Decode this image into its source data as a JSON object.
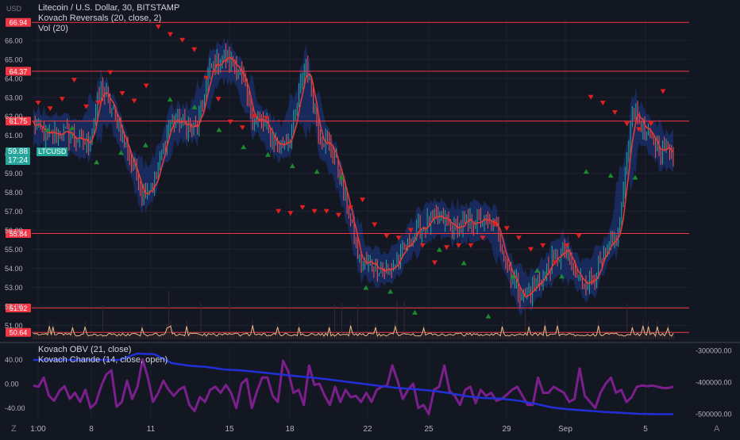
{
  "header": {
    "title": "Litecoin / U.S. Dollar, 30, BITSTAMP",
    "indicator_1": "Kovach Reversals (20, close, 2)",
    "indicator_2": "Vol (20)"
  },
  "currency_label": "USD",
  "lower_pane": {
    "indicator_1": "Kovach OBV (21, close)",
    "indicator_2": "Kovach Chande (14, close, open)"
  },
  "price_tag": {
    "symbol": "LTCUSD",
    "price": "59.88",
    "countdown": "17:24"
  },
  "corner": {
    "z": "Z",
    "a": "A"
  },
  "colors": {
    "background": "#131722",
    "level_line": "#f23645",
    "candle_up": "#26a69a",
    "candle_down": "#ef5350",
    "band": "#1e3a8a",
    "ma": "#e53935",
    "buy_marker": "#1b8a2f",
    "sell_marker": "#e0201f",
    "obv": "#2130d6",
    "chande": "#7b1f8c",
    "volume": "#e9b98a"
  },
  "chart_data": [
    {
      "type": "line",
      "title": "Litecoin / U.S. Dollar, 30, BITSTAMP",
      "x_tick_labels": [
        "1:00",
        "8",
        "11",
        "15",
        "18",
        "22",
        "25",
        "29",
        "Sep",
        "5"
      ],
      "y_tick_labels": [
        "51.00",
        "52.00",
        "53.00",
        "54.00",
        "55.00",
        "56.00",
        "57.00",
        "58.00",
        "59.00",
        "60.00",
        "61.00",
        "62.00",
        "63.00",
        "64.00",
        "65.00",
        "66.00"
      ],
      "ylim": [
        50.4,
        67.2
      ],
      "horizontal_levels": [
        66.94,
        64.37,
        61.75,
        55.84,
        51.92,
        50.64
      ],
      "last_price": 59.88,
      "series": [
        {
          "x": [
            "1:00",
            "3",
            "5",
            "6",
            "7",
            "8",
            "8",
            "9",
            "10",
            "10",
            "11",
            "11",
            "12",
            "13",
            "13",
            "14",
            "14",
            "15",
            "15",
            "16",
            "17",
            "17",
            "18",
            "18",
            "19",
            "20",
            "21",
            "22",
            "22",
            "23",
            "24",
            "25",
            "25",
            "26",
            "27",
            "28",
            "29",
            "29",
            "30",
            "31",
            "31",
            "Sep",
            "Sep",
            "3",
            "4",
            "5",
            "5",
            "6"
          ],
          "values": [
            61.6,
            60.9,
            61.2,
            60.9,
            60.5,
            63.5,
            62.0,
            60.0,
            58.0,
            58.6,
            61.8,
            61.6,
            61.3,
            64.5,
            65.1,
            64.7,
            62.1,
            61.5,
            60.4,
            61.1,
            64.9,
            61.0,
            60.2,
            57.5,
            54.2,
            54.3,
            53.8,
            54.6,
            55.9,
            56.4,
            56.6,
            56.1,
            56.4,
            56.5,
            56.2,
            53.8,
            52.4,
            53.2,
            54.2,
            55.0,
            53.4,
            53.4,
            54.6,
            55.9,
            62.5,
            61.1,
            60.3,
            60.2
          ]
        }
      ],
      "sell_markers": [
        62.7,
        62.4,
        62.9,
        63.9,
        62.5,
        62.7,
        64.3,
        63.2,
        62.8,
        63.6,
        66.7,
        66.3,
        66.0,
        65.5,
        64.0,
        62.9,
        61.7,
        61.4,
        62.0,
        61.9,
        57.0,
        56.9,
        57.2,
        57.0,
        57.0,
        56.8,
        57.2,
        57.6,
        56.3,
        55.7,
        55.6,
        56.0,
        55.2,
        54.3,
        55.1,
        55.2,
        55.2,
        55.6,
        56.3,
        56.1,
        55.6,
        55.0,
        55.2,
        54.3,
        55.2,
        55.7,
        63.0,
        62.7,
        62.2,
        61.6,
        61.3,
        61.6,
        63.3
      ],
      "buy_markers": [
        61.3,
        61.4,
        59.6,
        60.1,
        60.5,
        62.9,
        62.5,
        61.3,
        60.4,
        60.0,
        59.4,
        59.1,
        58.8,
        53.0,
        52.8,
        51.7,
        55.0,
        54.3,
        51.5,
        53.6,
        53.9,
        53.6,
        59.1,
        58.9,
        58.8
      ]
    },
    {
      "type": "line",
      "y_tick_labels": [
        "40.00",
        "0.00",
        "-40.00"
      ],
      "ylim": [
        -60,
        60
      ],
      "series": [
        {
          "name": "Kovach OBV (21, close)",
          "axis": "right",
          "values": [
            -330000,
            -330000,
            -330000,
            -330000,
            -330000,
            -330000,
            -310000,
            -312000,
            -340000,
            -348000,
            -352000,
            -360000,
            -363000,
            -368000,
            -374000,
            -380000,
            -385000,
            -391000,
            -398000,
            -405000,
            -412000,
            -418000,
            -422000,
            -427000,
            -434000,
            -444000,
            -450000,
            -452000,
            -458000,
            -468000,
            -480000,
            -486000,
            -490000,
            -494000,
            -497000,
            -500000,
            -501000,
            -501000
          ],
          "right_axis_ticks": [
            "300000.00",
            "400000.00",
            "500000.00"
          ]
        },
        {
          "name": "Kovach Chande (14, close, open)",
          "axis": "left",
          "values": [
            -3,
            -5,
            10,
            -20,
            -28,
            -12,
            -4,
            -25,
            -15,
            -30,
            -10,
            -40,
            -32,
            -5,
            15,
            22,
            -38,
            -30,
            5,
            -25,
            -5,
            40,
            10,
            -30,
            -15,
            5,
            -10,
            -20,
            -10,
            -5,
            -35,
            -45,
            -22,
            -30,
            -10,
            -5,
            -15,
            -2,
            -15,
            -40,
            0,
            8,
            -40,
            -12,
            10,
            10,
            -20,
            -30,
            38,
            20,
            -15,
            -10,
            -35,
            30,
            -2,
            0,
            -20,
            -35,
            -5,
            -30,
            -10,
            -22,
            -20,
            -30,
            -15,
            -30,
            -10,
            -5,
            -3,
            30,
            5,
            -25,
            -10,
            0,
            -40,
            -35,
            -50,
            -10,
            -5,
            30,
            -12,
            -20,
            -35,
            -10,
            -5,
            -32,
            -10,
            -20,
            -15,
            -28,
            -25,
            -18,
            -10,
            -5,
            -20,
            -35,
            -35,
            10,
            -15,
            -15,
            -5,
            -10,
            -15,
            -30,
            -25,
            25,
            -20,
            -30,
            -40,
            -15,
            0,
            10,
            -15,
            -10,
            -30,
            -22,
            -5,
            -3,
            -4,
            -3,
            -5,
            -7,
            -7,
            -5
          ]
        }
      ]
    }
  ]
}
